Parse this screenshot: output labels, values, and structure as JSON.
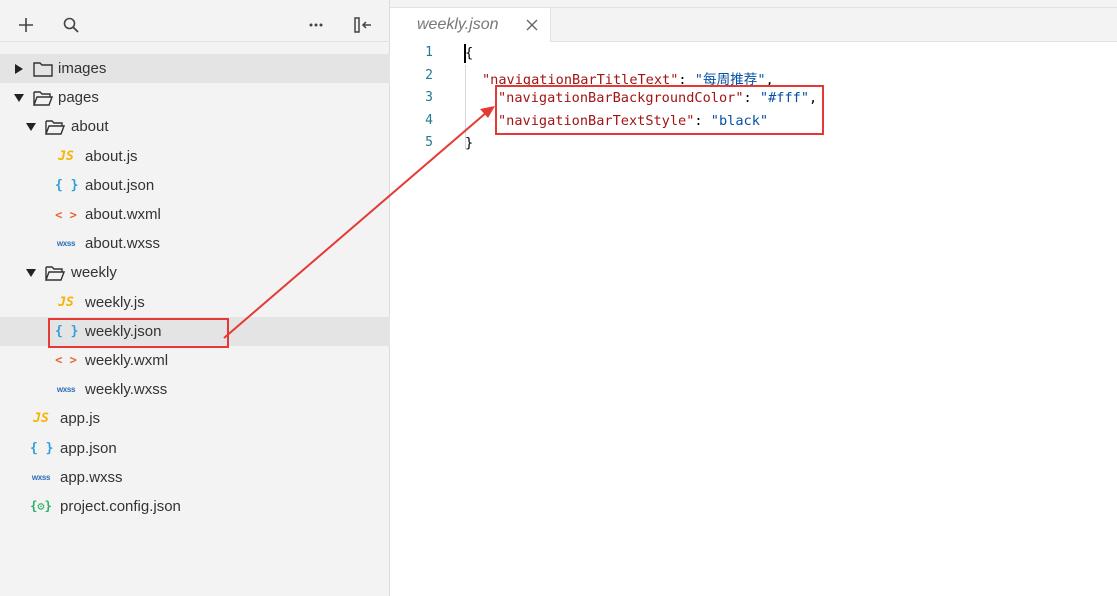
{
  "toolbar": {
    "add": "add-icon",
    "search": "search-icon",
    "more": "more-icon",
    "collapse": "collapse-panel-icon"
  },
  "tree": [
    {
      "label": "images",
      "kind": "folder",
      "expanded": false
    },
    {
      "label": "pages",
      "kind": "folder",
      "expanded": true
    },
    {
      "label": "about",
      "kind": "folder",
      "expanded": true
    },
    {
      "label": "about.js",
      "icon": "JS"
    },
    {
      "label": "about.json",
      "icon": "{ }"
    },
    {
      "label": "about.wxml",
      "icon": "< >"
    },
    {
      "label": "about.wxss",
      "icon": "wxss"
    },
    {
      "label": "weekly",
      "kind": "folder",
      "expanded": true
    },
    {
      "label": "weekly.js",
      "icon": "JS"
    },
    {
      "label": "weekly.json",
      "icon": "{ }",
      "selected": true
    },
    {
      "label": "weekly.wxml",
      "icon": "< >"
    },
    {
      "label": "weekly.wxss",
      "icon": "wxss"
    },
    {
      "label": "app.js",
      "icon": "JS"
    },
    {
      "label": "app.json",
      "icon": "{ }"
    },
    {
      "label": "app.wxss",
      "icon": "wxss"
    },
    {
      "label": "project.config.json",
      "icon": "{⚙}"
    }
  ],
  "tab": {
    "title": "weekly.json",
    "close": "close-icon"
  },
  "editor": {
    "line_numbers": [
      "1",
      "2",
      "3",
      "4",
      "5"
    ],
    "lines": [
      {
        "open_brace": "{"
      },
      {
        "key": "\"navigationBarTitleText\"",
        "colon": ": ",
        "value": "\"每周推荐\"",
        "comma": ","
      },
      {
        "key": "\"navigationBarBackgroundColor\"",
        "colon": ": ",
        "value": "\"#fff\"",
        "comma": ","
      },
      {
        "key": "\"navigationBarTextStyle\"",
        "colon": ": ",
        "value": "\"black\"",
        "comma": ""
      },
      {
        "close_brace": "}"
      }
    ]
  },
  "colors": {
    "annotation": "#e53935",
    "json_key": "#a31515",
    "json_string": "#0451a5",
    "line_number": "#237893"
  }
}
